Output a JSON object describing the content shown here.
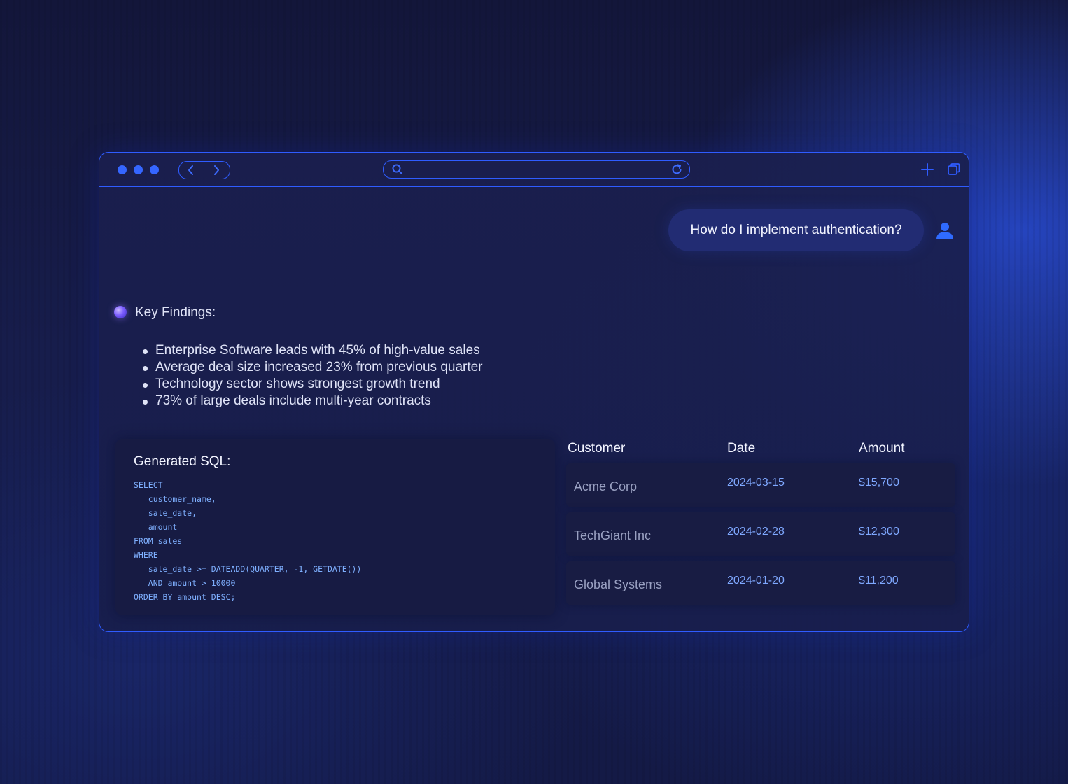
{
  "user_message": "How do I implement authentication?",
  "assistant": {
    "findings_title": "Key Findings:",
    "findings": [
      "Enterprise Software leads with 45% of high-value sales",
      "Average deal size increased 23% from previous quarter",
      "Technology sector shows strongest growth trend",
      "73% of large deals include multi-year contracts"
    ]
  },
  "sql": {
    "title": "Generated SQL:",
    "code": "SELECT\n   customer_name,\n   sale_date,\n   amount\nFROM sales\nWHERE\n   sale_date >= DATEADD(QUARTER, -1, GETDATE())\n   AND amount > 10000\nORDER BY amount DESC;"
  },
  "table": {
    "headers": [
      "Customer",
      "Date",
      "Amount"
    ],
    "rows": [
      {
        "customer": "Acme Corp",
        "date": "2024-03-15",
        "amount": "$15,700"
      },
      {
        "customer": "TechGiant Inc",
        "date": "2024-02-28",
        "amount": "$12,300"
      },
      {
        "customer": "Global Systems",
        "date": "2024-01-20",
        "amount": "$11,200"
      }
    ]
  },
  "icons": {
    "window_controls": [
      "window-dot-icon",
      "window-dot-icon",
      "window-dot-icon"
    ],
    "nav": [
      "chevron-left-icon",
      "chevron-right-icon"
    ],
    "address": [
      "search-icon",
      "refresh-icon"
    ],
    "toolbar_right": [
      "plus-icon",
      "tabs-icon"
    ],
    "user": "user-icon"
  },
  "colors": {
    "accent": "#2f5cff",
    "code": "#7fb0ff",
    "bubble": "#222c73"
  }
}
